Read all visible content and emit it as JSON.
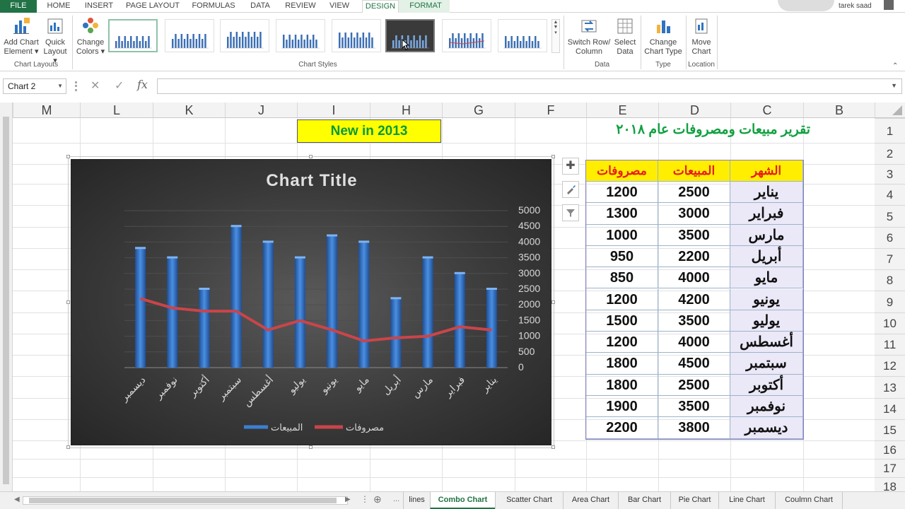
{
  "ribbon_tabs": [
    "FILE",
    "HOME",
    "INSERT",
    "PAGE LAYOUT",
    "FORMULAS",
    "DATA",
    "REVIEW",
    "VIEW",
    "DESIGN",
    "FORMAT"
  ],
  "active_tab": "DESIGN",
  "user_name": "tarek saad",
  "ribbon": {
    "add_chart_element": [
      "Add Chart",
      "Element ▾"
    ],
    "quick_layout": [
      "Quick",
      "Layout ▾"
    ],
    "change_colors": [
      "Change",
      "Colors ▾"
    ],
    "switch_row_column": [
      "Switch Row/",
      "Column"
    ],
    "select_data": [
      "Select",
      "Data"
    ],
    "change_chart_type": [
      "Change",
      "Chart Type"
    ],
    "move_chart": [
      "Move",
      "Chart"
    ],
    "groups": {
      "chart_layouts": "Chart Layouts",
      "chart_styles": "Chart Styles",
      "data": "Data",
      "type": "Type",
      "location": "Location"
    }
  },
  "namebox": "Chart 2",
  "columns": [
    "M",
    "L",
    "K",
    "J",
    "I",
    "H",
    "G",
    "F",
    "E",
    "D",
    "C",
    "B"
  ],
  "rows": [
    "1",
    "2",
    "3",
    "4",
    "5",
    "6",
    "7",
    "8",
    "9",
    "10",
    "11",
    "12",
    "13",
    "14",
    "15",
    "16",
    "17",
    "18"
  ],
  "banner_text": "New in 2013",
  "report_title": "تقرير مبيعات ومصروفات عام ٢٠١٨",
  "table": {
    "headers": [
      "مصروفات",
      "المبيعات",
      "الشهر"
    ],
    "rows": [
      {
        "expenses": "1200",
        "sales": "2500",
        "month": "يناير"
      },
      {
        "expenses": "1300",
        "sales": "3000",
        "month": "فبراير"
      },
      {
        "expenses": "1000",
        "sales": "3500",
        "month": "مارس"
      },
      {
        "expenses": "950",
        "sales": "2200",
        "month": "أبريل"
      },
      {
        "expenses": "850",
        "sales": "4000",
        "month": "مايو"
      },
      {
        "expenses": "1200",
        "sales": "4200",
        "month": "يونيو"
      },
      {
        "expenses": "1500",
        "sales": "3500",
        "month": "يوليو"
      },
      {
        "expenses": "1200",
        "sales": "4000",
        "month": "أغسطس"
      },
      {
        "expenses": "1800",
        "sales": "4500",
        "month": "سبتمبر"
      },
      {
        "expenses": "1800",
        "sales": "2500",
        "month": "أكتوبر"
      },
      {
        "expenses": "1900",
        "sales": "3500",
        "month": "نوفمبر"
      },
      {
        "expenses": "2200",
        "sales": "3800",
        "month": "ديسمبر"
      }
    ]
  },
  "chart_data": {
    "type": "bar",
    "title": "Chart Title",
    "categories": [
      "يناير",
      "فبراير",
      "مارس",
      "أبريل",
      "مايو",
      "يونيو",
      "يوليو",
      "أغسطس",
      "سبتمبر",
      "أكتوبر",
      "نوفمبر",
      "ديسمبر"
    ],
    "series": [
      {
        "name": "المبيعات",
        "kind": "bar",
        "color": "#3d7fd0",
        "values": [
          2500,
          3000,
          3500,
          2200,
          4000,
          4200,
          3500,
          4000,
          4500,
          2500,
          3500,
          3800
        ]
      },
      {
        "name": "مصروفات",
        "kind": "line",
        "color": "#c9454a",
        "values": [
          1200,
          1300,
          1000,
          950,
          850,
          1200,
          1500,
          1200,
          1800,
          1800,
          1900,
          2200
        ]
      }
    ],
    "y_ticks": [
      "0",
      "500",
      "1000",
      "1500",
      "2000",
      "2500",
      "3000",
      "3500",
      "4000",
      "4500",
      "5000"
    ],
    "ylim": [
      0,
      5000
    ],
    "y_axis_side": "right",
    "category_order": "right-to-left",
    "grid": true,
    "legend": "bottom"
  },
  "sheet_tabs": [
    "lines",
    "Combo Chart",
    "Scatter  Chart",
    "Area Chart",
    "Bar Chart",
    "Pie Chart",
    "Line Chart",
    "Coulmn Chart"
  ],
  "active_sheet": "Combo Chart"
}
